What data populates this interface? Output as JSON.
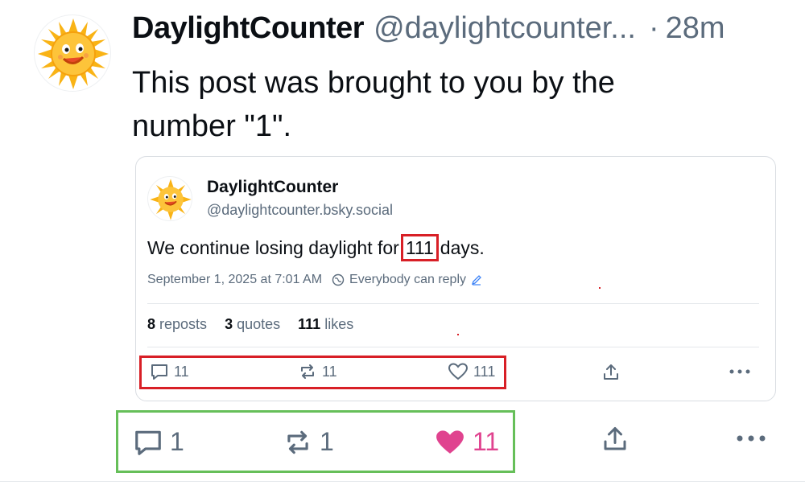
{
  "post": {
    "avatar_icon": "sun-face-icon",
    "author_name": "DaylightCounter",
    "author_handle": "@daylightcounter...",
    "separator": "·",
    "time": "28m",
    "text": "This post was brought to you by the number \"1\"."
  },
  "quoted_post": {
    "avatar_icon": "sun-face-icon",
    "author_name": "DaylightCounter",
    "author_handle": "@daylightcounter.bsky.social",
    "text_before": "We continue losing daylight for",
    "text_number": "111",
    "text_after": "days.",
    "timestamp": "September 1, 2025 at 7:01 AM",
    "reply_setting": "Everybody can reply",
    "stats": {
      "reposts_count": "8",
      "reposts_label": "reposts",
      "quotes_count": "3",
      "quotes_label": "quotes",
      "likes_count": "111",
      "likes_label": "likes"
    },
    "actions": {
      "reply_count": "11",
      "repost_count": "11",
      "like_count": "111"
    }
  },
  "actions": {
    "reply_count": "1",
    "repost_count": "1",
    "like_count": "11"
  },
  "colors": {
    "highlight_red": "#d81f26",
    "highlight_green": "#66bf59",
    "like_pink": "#e0438f",
    "muted_text": "#5b6b7c"
  }
}
